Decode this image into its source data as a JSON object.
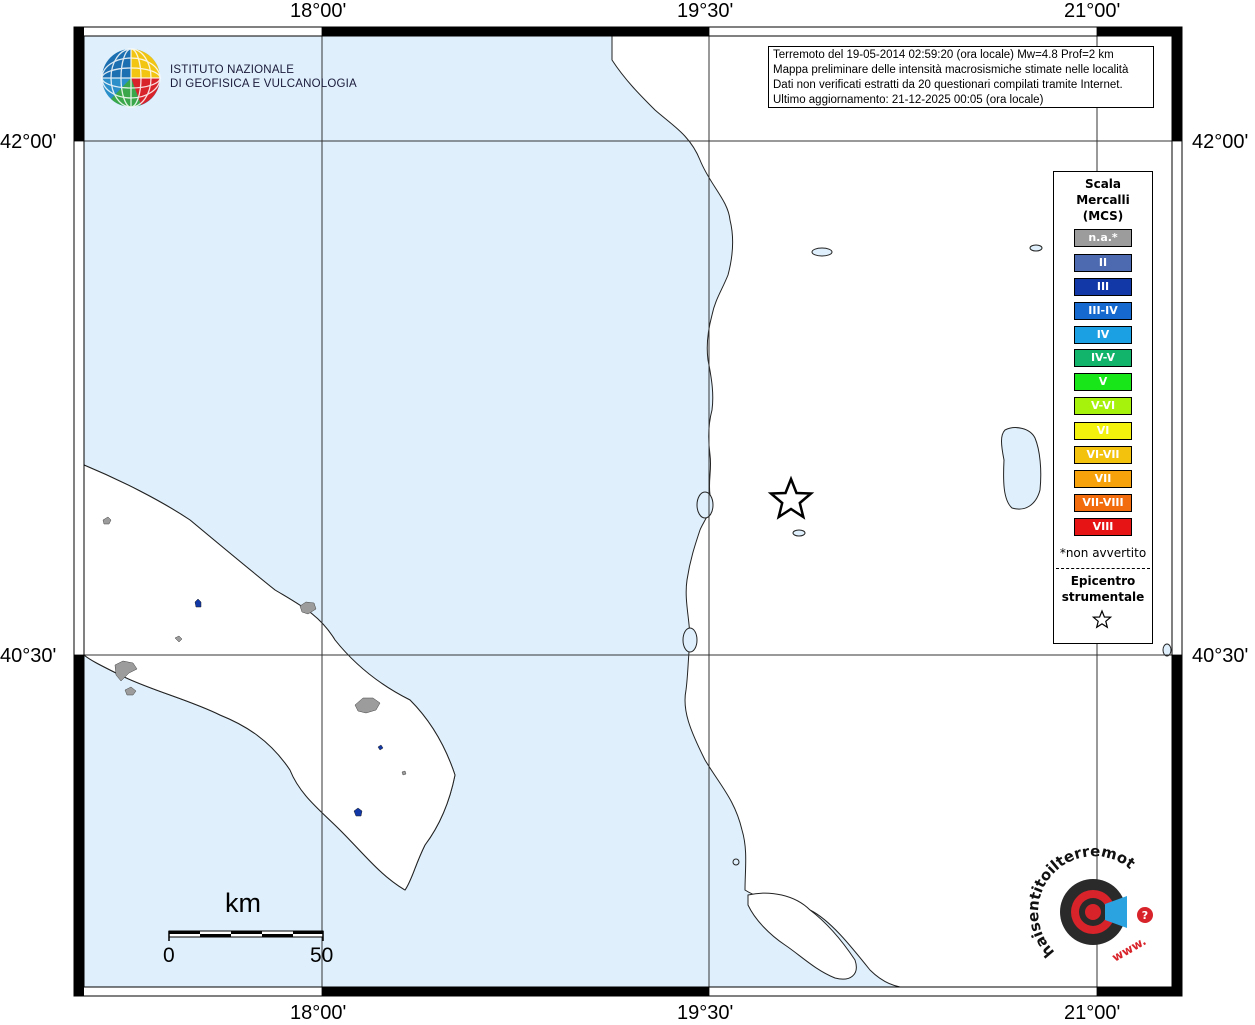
{
  "institute": {
    "name_line1": "ISTITUTO NAZIONALE",
    "name_line2": "DI GEOFISICA E VULCANOLOGIA",
    "logo_icon": "ingv-globe-logo"
  },
  "info": {
    "line1": "Terremoto del 19-05-2014 02:59:20 (ora locale) Mw=4.8 Prof=2 km",
    "line2": "Mappa preliminare delle intensità macrosismiche stimate nelle località",
    "line3": "Dati non verificati estratti da 20 questionari compilati tramite Internet.",
    "line4": "Ultimo aggiornamento: 21-12-2025 00:05 (ora locale)"
  },
  "axes": {
    "lon_labels": [
      "18°00'",
      "19°30'",
      "21°00'"
    ],
    "lat_labels": [
      "42°00'",
      "40°30'"
    ]
  },
  "legend": {
    "title_line1": "Scala",
    "title_line2": "Mercalli",
    "title_line3": "(MCS)",
    "items": [
      {
        "label": "n.a.*",
        "color": "#9c9c9c"
      },
      {
        "label": "II",
        "color": "#4d6ab0"
      },
      {
        "label": "III",
        "color": "#1238a8"
      },
      {
        "label": "III-IV",
        "color": "#1669cf"
      },
      {
        "label": "IV",
        "color": "#1aa0e3"
      },
      {
        "label": "IV-V",
        "color": "#12b36a"
      },
      {
        "label": "V",
        "color": "#19e619"
      },
      {
        "label": "V-VI",
        "color": "#a6f20d"
      },
      {
        "label": "VI",
        "color": "#f2f20d"
      },
      {
        "label": "VI-VII",
        "color": "#f2c20d"
      },
      {
        "label": "VII",
        "color": "#f7a20a"
      },
      {
        "label": "VII-VIII",
        "color": "#f26b0d"
      },
      {
        "label": "VIII",
        "color": "#e61414"
      }
    ],
    "note": "*non avvertito",
    "epicenter_line1": "Epicentro",
    "epicenter_line2": "strumentale",
    "epicenter_icon": "star-icon"
  },
  "scale_bar": {
    "unit": "km",
    "min_label": "0",
    "max_label": "50"
  },
  "hst_logo": {
    "text_arc": "haisentitoilterremoto.it",
    "www": "www.",
    "question": "?"
  },
  "colors": {
    "sea": "#dff0fc",
    "land": "#ffffff",
    "municipality_gray": "#9c9c9c",
    "municipality_blue": "#1238a8"
  }
}
